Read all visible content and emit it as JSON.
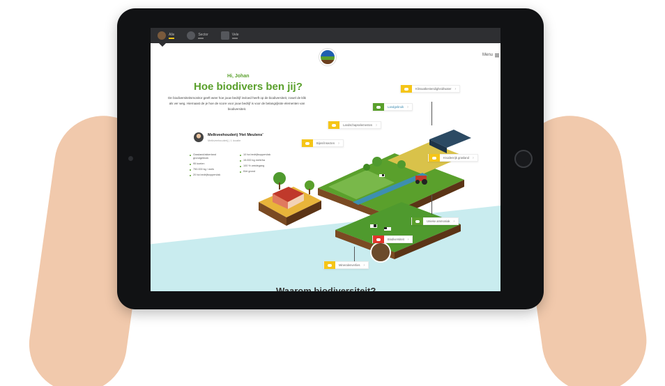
{
  "topbar": {
    "tabs": [
      {
        "label": "Alle",
        "active": true
      },
      {
        "label": "Sector",
        "active": false
      },
      {
        "label": "Vele",
        "active": false
      }
    ]
  },
  "menu_label": "Menu",
  "greeting": "Hi, Johan",
  "headline": "Hoe biodivers ben jij?",
  "intro_text": "De biodiversiteitsmonitor geeft weer hoe jouw bedrijf invloed heeft op de biodiversiteit, zowel de klik als ver weg. Hiernaast de je hoe de score voor jouw bedrijf is voor de belangrijkste elementen van biodiversiteit.",
  "farmer": {
    "name": "Melkveehouderij 'Het Meulens'",
    "subtitle": "Melkveehouderij | 1 locatie"
  },
  "stats_left": [
    "Grasland/akkerland grondgebruik",
    "95 koeien",
    "750.000 kg / melk",
    "20 ha bedrijfsoppervlak"
  ],
  "stats_right": [
    "10 ha bedrijfsoppervlak",
    "15.000 kg melk/ha",
    "100 % weidegang",
    "Klei grond"
  ],
  "callouts": [
    {
      "label": "Klimaatbestendigheid/water",
      "color": "#f5c518"
    },
    {
      "label": "Landgebruik",
      "color": "#5aa02c"
    },
    {
      "label": "Landschapselementen",
      "color": "#f5c518"
    },
    {
      "label": "Bijen/insecten",
      "color": "#f5c518"
    },
    {
      "label": "Kruidenrijk grasland",
      "color": "#f5c518"
    },
    {
      "label": "Unieke ammoniak",
      "color": "#5aa02c"
    },
    {
      "label": "Biodiversiteit",
      "color": "#e0352b"
    },
    {
      "label": "Mineralenverlies",
      "color": "#f5c518"
    }
  ],
  "bottom_title": "Waarom biodiversiteit?",
  "colors": {
    "accent": "#5aa02c",
    "topbar": "#2e2f32",
    "water": "#c9ecef"
  }
}
